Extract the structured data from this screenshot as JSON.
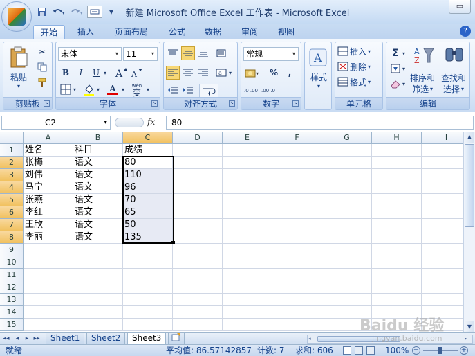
{
  "window": {
    "title": "新建 Microsoft Office Excel 工作表 - Microsoft Excel",
    "control_glyph": "▭"
  },
  "quick_access": {
    "save_icon": "save-icon",
    "undo_icon": "undo-icon",
    "redo_icon": "redo-icon",
    "customize_icon": "customize-icon"
  },
  "ribbon_tabs": [
    "开始",
    "插入",
    "页面布局",
    "公式",
    "数据",
    "审阅",
    "视图"
  ],
  "help": "?",
  "ribbon": {
    "clipboard": {
      "paste_label": "粘贴",
      "group_label": "剪贴板"
    },
    "font": {
      "font_name": "宋体",
      "font_size": "11",
      "group_label": "字体",
      "bold": "B",
      "italic": "I",
      "underline": "U",
      "font_color_letter": "A",
      "wen": "wén",
      "bian": "变"
    },
    "alignment": {
      "group_label": "对齐方式"
    },
    "number": {
      "format": "常规",
      "group_label": "数字",
      "percent": "%",
      "comma": ",",
      "dec_inc": ".0 .00",
      "dec_dec": ".00 .0"
    },
    "styles": {
      "label": "样式"
    },
    "cells": {
      "insert": "插入",
      "delete": "删除",
      "format": "格式",
      "group_label": "单元格"
    },
    "editing": {
      "sum": "Σ",
      "sort_filter_1": "排序和",
      "sort_filter_2": "筛选",
      "find_select_1": "查找和",
      "find_select_2": "选择",
      "group_label": "编辑"
    }
  },
  "formula_bar": {
    "name_box": "C2",
    "fx": "fx",
    "value": "80"
  },
  "columns": [
    "A",
    "B",
    "C",
    "D",
    "E",
    "F",
    "G",
    "H",
    "I"
  ],
  "rows": [
    "1",
    "2",
    "3",
    "4",
    "5",
    "6",
    "7",
    "8",
    "9",
    "10",
    "11",
    "12",
    "13",
    "14",
    "15"
  ],
  "cells": {
    "header": [
      "姓名",
      "科目",
      "成绩"
    ],
    "data": [
      [
        "张梅",
        "语文",
        "80"
      ],
      [
        "刘伟",
        "语文",
        "110"
      ],
      [
        "马宁",
        "语文",
        "96"
      ],
      [
        "张燕",
        "语文",
        "70"
      ],
      [
        "李红",
        "语文",
        "65"
      ],
      [
        "王欣",
        "语文",
        "50"
      ],
      [
        "李丽",
        "语文",
        "135"
      ]
    ]
  },
  "sheets": [
    "Sheet1",
    "Sheet2",
    "Sheet3"
  ],
  "status": {
    "ready": "就绪",
    "average": "平均值: 86.57142857",
    "count": "计数: 7",
    "sum": "求和: 606",
    "zoom": "100%"
  },
  "watermark": {
    "text": "Baidu 经验",
    "url": "jingyan.baidu.com"
  }
}
